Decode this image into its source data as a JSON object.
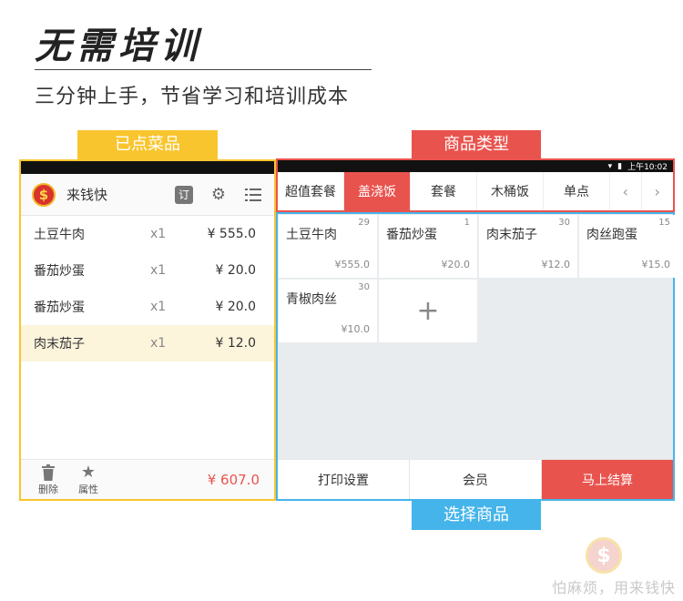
{
  "hero": {
    "title": "无需培训",
    "subtitle": "三分钟上手，节省学习和培训成本"
  },
  "labels": {
    "ordered": "已点菜品",
    "category": "商品类型",
    "select": "选择商品"
  },
  "left": {
    "logo_glyph": "$",
    "app_name": "来钱快",
    "order_icon_text": "订",
    "orders": [
      {
        "name": "土豆牛肉",
        "qty": "x1",
        "price": "¥ 555.0"
      },
      {
        "name": "番茄炒蛋",
        "qty": "x1",
        "price": "¥ 20.0"
      },
      {
        "name": "番茄炒蛋",
        "qty": "x1",
        "price": "¥ 20.0"
      },
      {
        "name": "肉末茄子",
        "qty": "x1",
        "price": "¥ 12.0"
      }
    ],
    "delete_label": "删除",
    "attr_label": "属性",
    "total": "¥ 607.0"
  },
  "right": {
    "status_time": "上午10:02",
    "tabs": [
      "超值套餐",
      "盖浇饭",
      "套餐",
      "木桶饭",
      "单点"
    ],
    "active_tab": "盖浇饭",
    "prev_glyph": "‹",
    "next_glyph": "›",
    "products": [
      {
        "name": "土豆牛肉",
        "count": "29",
        "price": "¥555.0"
      },
      {
        "name": "番茄炒蛋",
        "count": "1",
        "price": "¥20.0"
      },
      {
        "name": "肉末茄子",
        "count": "30",
        "price": "¥12.0"
      },
      {
        "name": "肉丝跑蛋",
        "count": "15",
        "price": "¥15.0"
      },
      {
        "name": "青椒肉丝",
        "count": "30",
        "price": "¥10.0"
      }
    ],
    "add_glyph": "+",
    "print_settings": "打印设置",
    "member": "会员",
    "checkout": "马上结算"
  },
  "watermark": {
    "coin_glyph": "$",
    "text": "怕麻烦，用来钱快"
  },
  "colors": {
    "yellow": "#f9c52e",
    "red": "#e9534e",
    "blue": "#45b4ea"
  }
}
